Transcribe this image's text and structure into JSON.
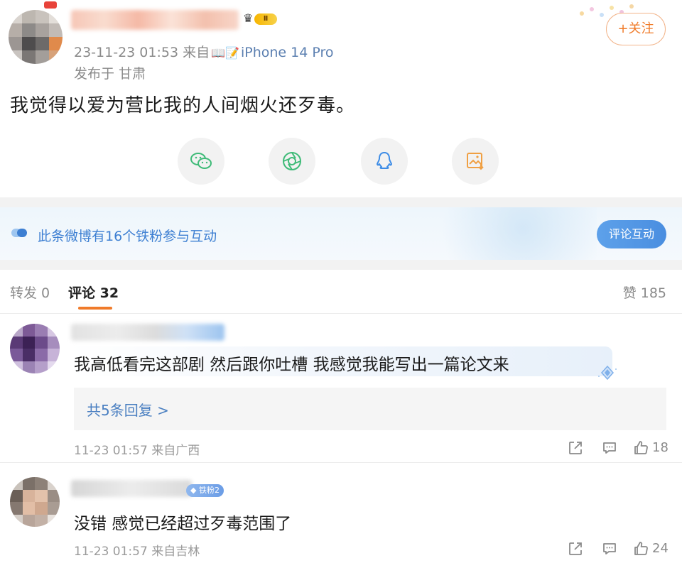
{
  "post": {
    "timestamp": "23-11-23 01:53",
    "source_prefix": "来自",
    "source_device": "iPhone 14 Pro",
    "location": "发布于 甘肃",
    "text": "我觉得以爱为营比我的人间烟火还歹毒。",
    "follow_label": "+关注",
    "badge_level": "Ⅱ"
  },
  "share_buttons": [
    {
      "name": "wechat",
      "color": "#3fbb78"
    },
    {
      "name": "moments",
      "color": "#3fbb78"
    },
    {
      "name": "qq",
      "color": "#3d8ce6"
    },
    {
      "name": "save-image",
      "color": "#f0a043"
    }
  ],
  "fan_banner": {
    "text": "此条微博有16个铁粉参与互动",
    "button_label": "评论互动"
  },
  "tabs": {
    "forward": "转发 0",
    "comment": "评论 32",
    "like": "赞 185"
  },
  "comments": [
    {
      "text": "我高低看完这部剧 然后跟你吐槽 我感觉我能写出一篇论文来",
      "replies_label": "共5条回复 >",
      "meta": "11-23 01:57 来自广西",
      "likes": "18"
    },
    {
      "fan_tag": "铁粉2",
      "text": "没错 感觉已经超过歹毒范围了",
      "meta": "11-23 01:57 来自吉林",
      "likes": "24"
    }
  ],
  "colors": {
    "accent_orange": "#f07b2a",
    "link_blue": "#4a7fc1",
    "banner_blue": "#3d7fd2"
  }
}
